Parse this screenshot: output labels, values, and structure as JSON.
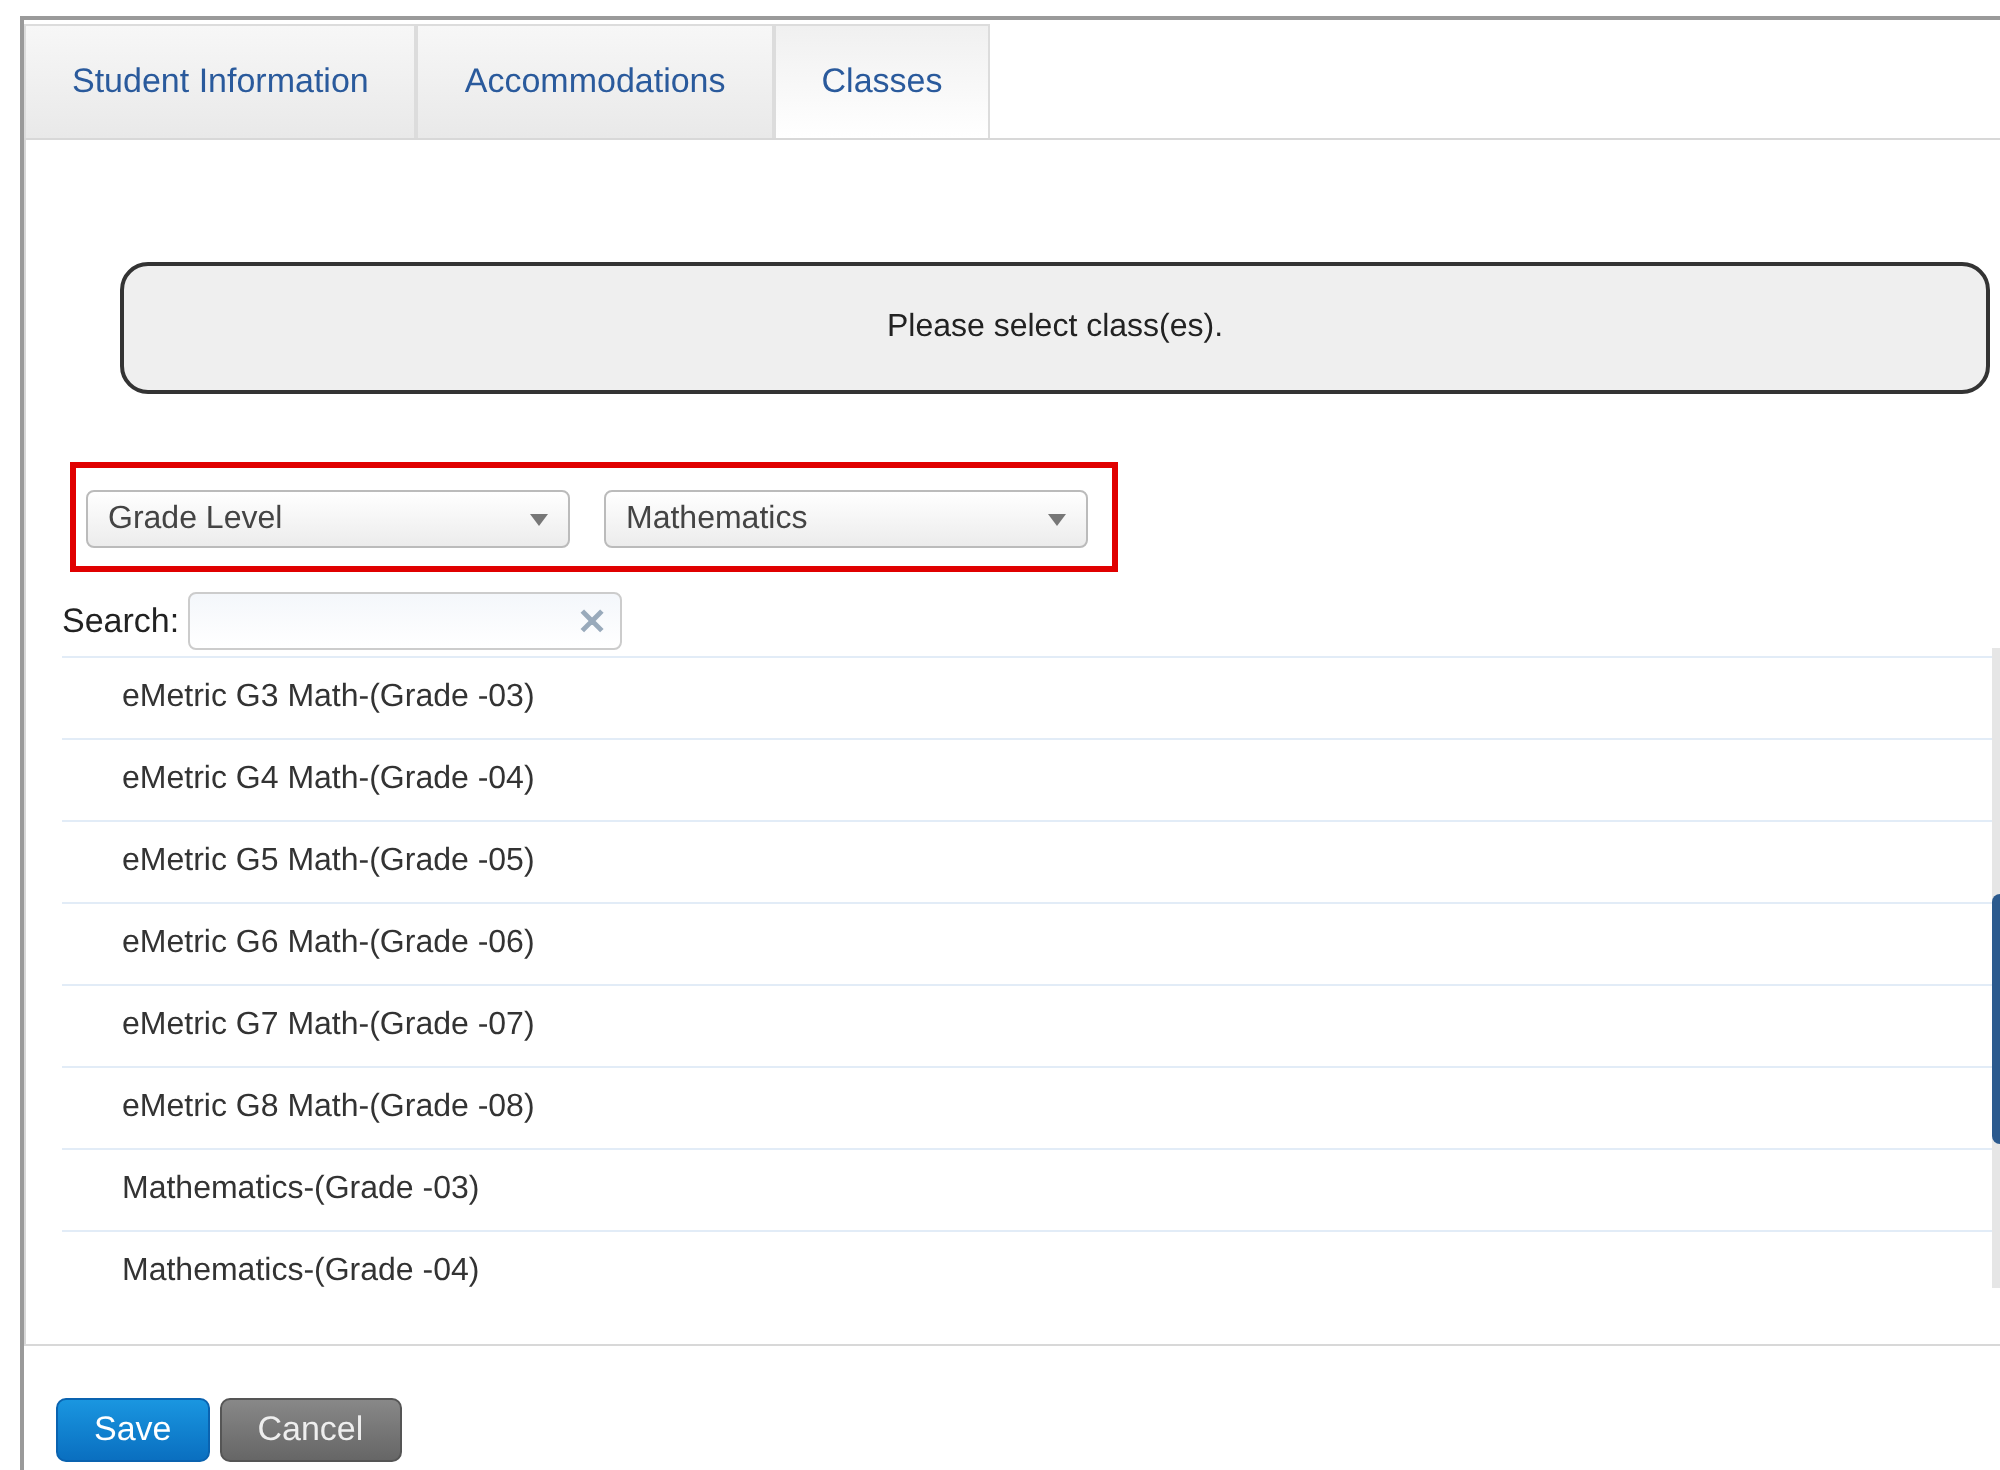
{
  "tabs": [
    {
      "label": "Student Information",
      "selected": false
    },
    {
      "label": "Accommodations",
      "selected": false
    },
    {
      "label": "Classes",
      "selected": true
    }
  ],
  "message": "Please select class(es).",
  "filters": [
    {
      "value": "Grade Level"
    },
    {
      "value": "Mathematics"
    }
  ],
  "search": {
    "label": "Search:",
    "clear": "✕"
  },
  "classes": [
    "eMetric G3 Math-(Grade -03)",
    "eMetric G4 Math-(Grade -04)",
    "eMetric G5 Math-(Grade -05)",
    "eMetric G6 Math-(Grade -06)",
    "eMetric G7 Math-(Grade -07)",
    "eMetric G8 Math-(Grade -08)",
    "Mathematics-(Grade -03)",
    "Mathematics-(Grade -04)"
  ],
  "buttons": [
    {
      "label": "Save",
      "kind": "primary"
    },
    {
      "label": "Cancel",
      "kind": "secondary"
    }
  ]
}
